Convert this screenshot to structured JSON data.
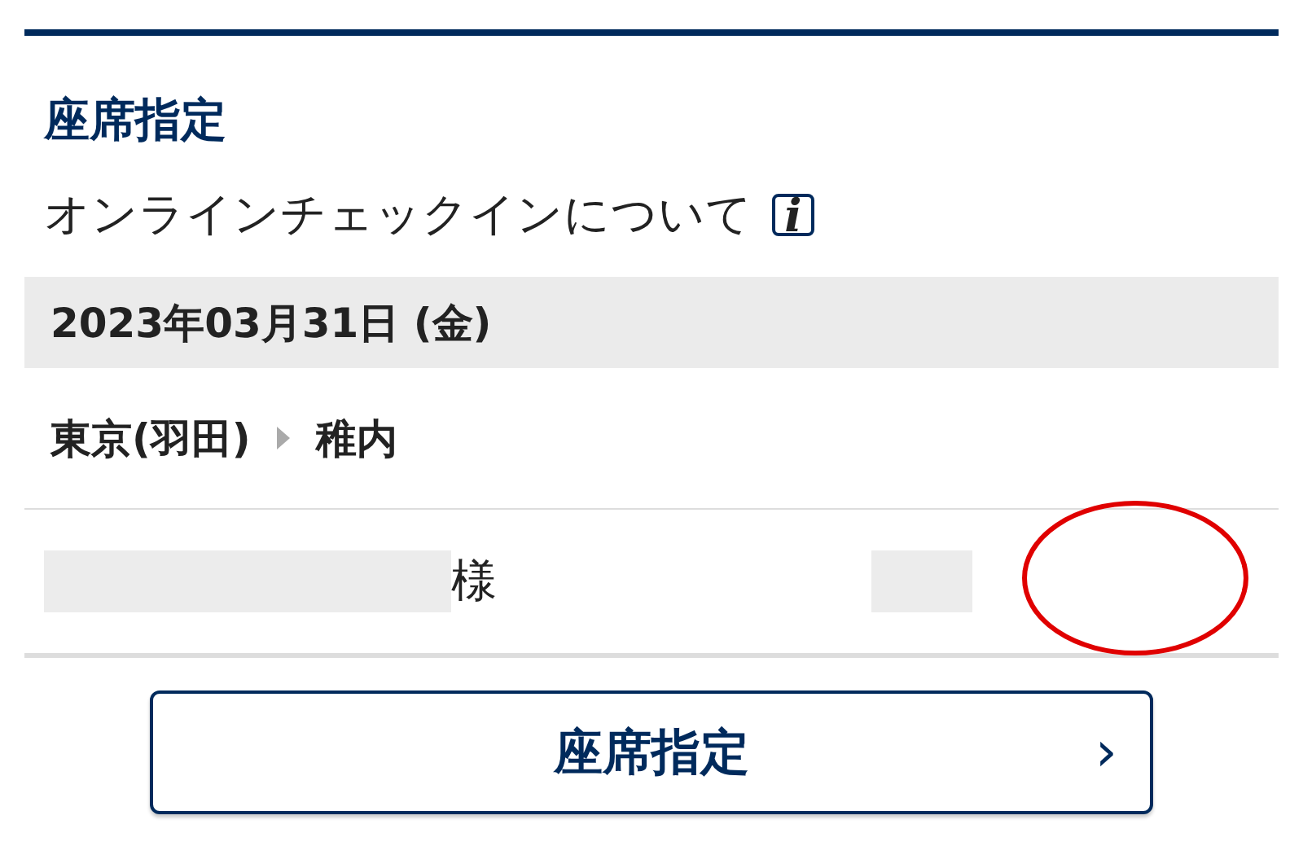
{
  "section": {
    "title": "座席指定"
  },
  "online_checkin_link": {
    "label": "オンラインチェックインについて",
    "icon": "i"
  },
  "flight": {
    "date": "2023年03月31日 (金)",
    "origin": "東京(羽田)",
    "destination": "稚内"
  },
  "passenger": {
    "honorific": "様"
  },
  "seat_button": {
    "label": "座席指定",
    "icon": "›"
  }
}
